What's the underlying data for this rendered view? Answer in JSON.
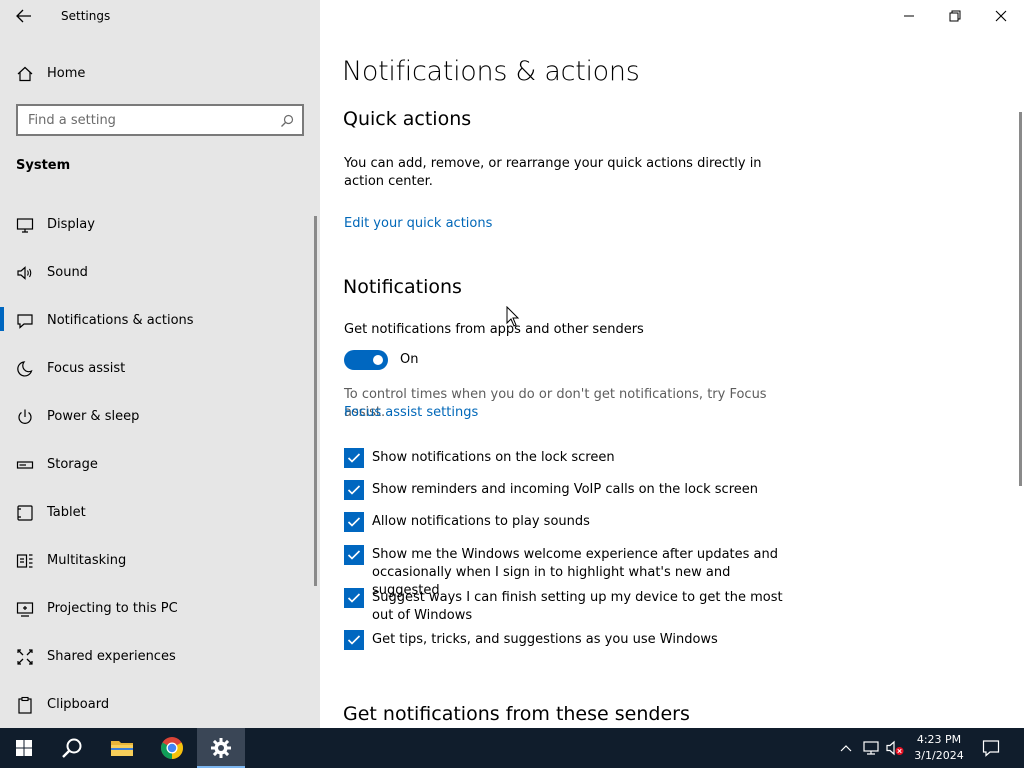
{
  "app": {
    "title": "Settings"
  },
  "sidebar": {
    "home_label": "Home",
    "search_placeholder": "Find a setting",
    "section": "System",
    "items": [
      {
        "label": "Display",
        "icon": "monitor-icon",
        "active": false
      },
      {
        "label": "Sound",
        "icon": "speaker-icon",
        "active": false
      },
      {
        "label": "Notifications & actions",
        "icon": "notification-icon",
        "active": true
      },
      {
        "label": "Focus assist",
        "icon": "moon-icon",
        "active": false
      },
      {
        "label": "Power & sleep",
        "icon": "power-icon",
        "active": false
      },
      {
        "label": "Storage",
        "icon": "storage-icon",
        "active": false
      },
      {
        "label": "Tablet",
        "icon": "tablet-icon",
        "active": false
      },
      {
        "label": "Multitasking",
        "icon": "multitasking-icon",
        "active": false
      },
      {
        "label": "Projecting to this PC",
        "icon": "projecting-icon",
        "active": false
      },
      {
        "label": "Shared experiences",
        "icon": "shared-icon",
        "active": false
      },
      {
        "label": "Clipboard",
        "icon": "clipboard-icon",
        "active": false
      }
    ]
  },
  "main": {
    "title": "Notifications & actions",
    "quick_actions": {
      "heading": "Quick actions",
      "description": "You can add, remove, or rearrange your quick actions directly in action center.",
      "link": "Edit your quick actions"
    },
    "notifications": {
      "heading": "Notifications",
      "toggle_caption": "Get notifications from apps and other senders",
      "toggle_state": "On",
      "focus_text": "To control times when you do or don't get notifications, try Focus assist.",
      "focus_link": "Focus assist settings",
      "checkboxes": [
        {
          "label": "Show notifications on the lock screen",
          "checked": true
        },
        {
          "label": "Show reminders and incoming VoIP calls on the lock screen",
          "checked": true
        },
        {
          "label": "Allow notifications to play sounds",
          "checked": true
        },
        {
          "label": "Show me the Windows welcome experience after updates and occasionally when I sign in to highlight what's new and suggested",
          "checked": true
        },
        {
          "label": "Suggest ways I can finish setting up my device to get the most out of Windows",
          "checked": true
        },
        {
          "label": "Get tips, tricks, and suggestions as you use Windows",
          "checked": true
        }
      ]
    },
    "senders_heading": "Get notifications from these senders"
  },
  "taskbar": {
    "time": "4:23 PM",
    "date": "3/1/2024",
    "pinned": [
      "start-icon",
      "search-icon",
      "file-explorer-icon",
      "chrome-icon",
      "settings-icon"
    ]
  },
  "colors": {
    "accent": "#0067c0",
    "link": "#0067b8",
    "sidebar_bg": "#e6e6e6",
    "taskbar_bg": "#101d2c"
  }
}
